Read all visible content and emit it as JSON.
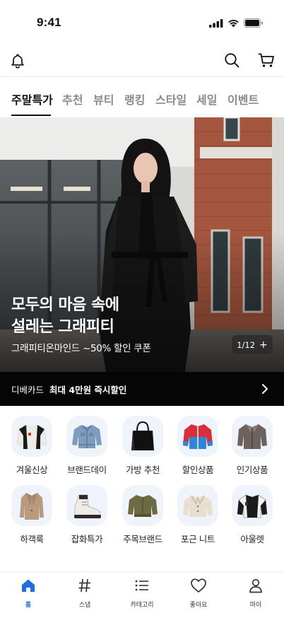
{
  "status": {
    "time": "9:41"
  },
  "header": {
    "icons": [
      "bell-icon",
      "search-icon",
      "cart-icon"
    ]
  },
  "tabs": [
    {
      "label": "주말특가",
      "active": true
    },
    {
      "label": "추천"
    },
    {
      "label": "뷰티"
    },
    {
      "label": "랭킹"
    },
    {
      "label": "스타일"
    },
    {
      "label": "세일"
    },
    {
      "label": "이벤트"
    }
  ],
  "hero": {
    "title_line1": "모두의 마음 속에",
    "title_line2": "설레는 그래피티",
    "subtitle": "그래피티온마인드 ~50% 할인 쿠폰",
    "pager": "1/12",
    "pager_icon": "+"
  },
  "promo": {
    "brand": "디베카드",
    "offer": "최대 4만원 즉시할인"
  },
  "categories": [
    {
      "label": "겨울신상"
    },
    {
      "label": "브랜드데이"
    },
    {
      "label": "가방 추천"
    },
    {
      "label": "할인상품"
    },
    {
      "label": "인기상품"
    },
    {
      "label": "하객룩"
    },
    {
      "label": "잡화특가"
    },
    {
      "label": "주목브랜드"
    },
    {
      "label": "포근 니트"
    },
    {
      "label": "아울렛"
    }
  ],
  "bottom_nav": [
    {
      "label": "홈",
      "icon": "home-icon",
      "active": true
    },
    {
      "label": "스냅",
      "icon": "hashtag-icon"
    },
    {
      "label": "카테고리",
      "icon": "list-icon"
    },
    {
      "label": "좋아요",
      "icon": "heart-icon"
    },
    {
      "label": "마이",
      "icon": "person-icon"
    }
  ],
  "colors": {
    "accent": "#1d6fe0",
    "promo_bg": "#050505",
    "thumb_bg": "#eef4fa"
  }
}
